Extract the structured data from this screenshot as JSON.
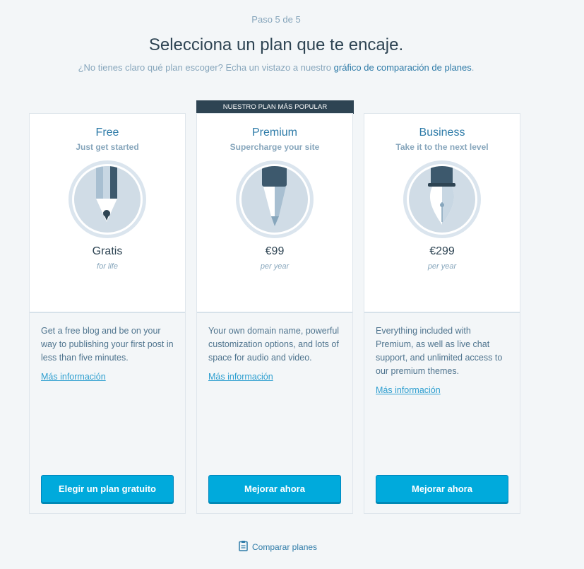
{
  "header": {
    "step": "Paso 5 de 5",
    "title": "Selecciona un plan que te encaje.",
    "subtitle_text": "¿No tienes claro qué plan escoger? Echa un vistazo a nuestro ",
    "subtitle_link": "gráfico de comparación de planes",
    "subtitle_end": "."
  },
  "popular_badge": "NUESTRO PLAN MÁS POPULAR",
  "plans": [
    {
      "name": "Free",
      "tagline": "Just get started",
      "price": "Gratis",
      "period": "for life",
      "description": "Get a free blog and be on your way to publishing your first post in less than five minutes.",
      "more": "Más información",
      "button": "Elegir un plan gratuito",
      "icon": "pencil-icon"
    },
    {
      "name": "Premium",
      "tagline": "Supercharge your site",
      "price": "€99",
      "period": "per year",
      "description": "Your own domain name, powerful customization options, and lots of space for audio and video.",
      "more": "Más información",
      "button": "Mejorar ahora",
      "icon": "marker-icon"
    },
    {
      "name": "Business",
      "tagline": "Take it to the next level",
      "price": "€299",
      "period": "per year",
      "description": "Everything included with Premium, as well as live chat support, and unlimited access to our premium themes.",
      "more": "Más información",
      "button": "Mejorar ahora",
      "icon": "fountain-pen-icon"
    }
  ],
  "footer": {
    "compare": "Comparar planes",
    "icon": "clipboard-icon"
  },
  "colors": {
    "accent": "#00aadc",
    "link": "#2e7ba8",
    "dark": "#2e4453",
    "muted": "#87a6bc"
  }
}
